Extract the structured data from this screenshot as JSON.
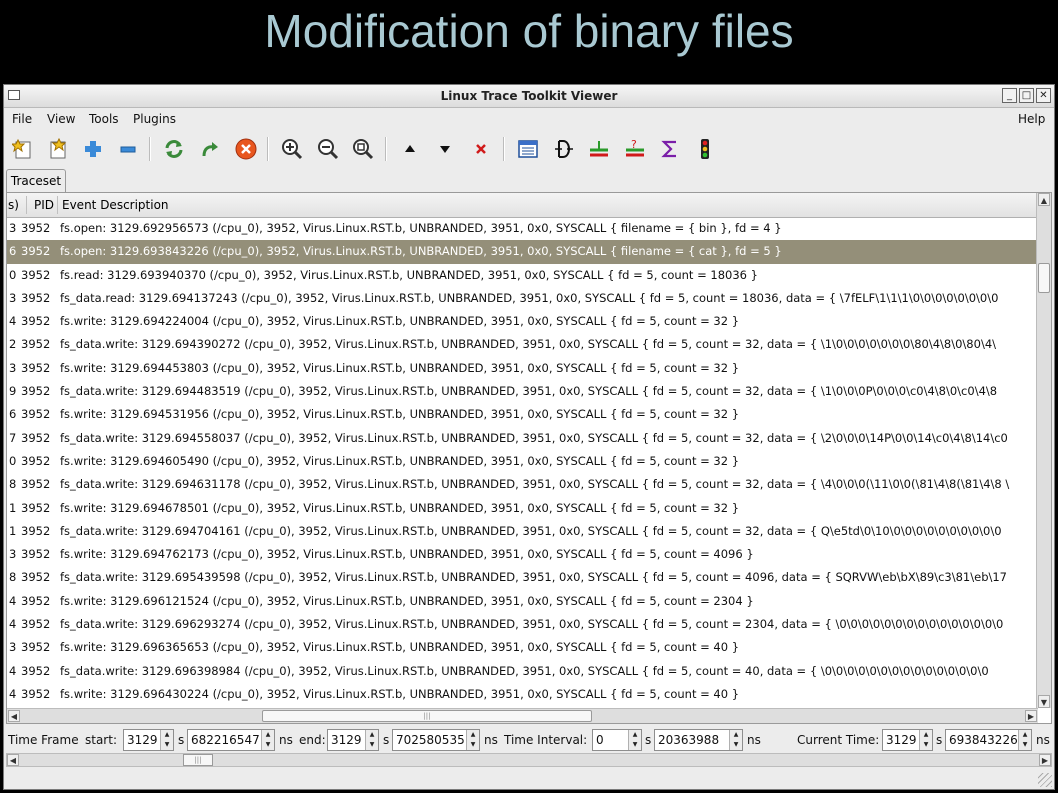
{
  "slide": {
    "title": "Modification of binary files"
  },
  "window": {
    "title": "Linux Trace Toolkit Viewer",
    "buttons": {
      "minimize": "_",
      "maximize": "□",
      "close": "✕"
    }
  },
  "menubar": {
    "file": "File",
    "view": "View",
    "tools": "Tools",
    "plugins": "Plugins",
    "help": "Help"
  },
  "toolbar": {
    "icons": [
      "open-trace-icon",
      "close-trace-icon",
      "add-trace-icon",
      "remove-trace-icon",
      "reload-icon",
      "redo-icon",
      "stop-icon",
      "zoom-in-icon",
      "zoom-out-icon",
      "zoom-fit-icon",
      "go-up-icon",
      "go-down-icon",
      "delete-icon",
      "event-list-icon",
      "control-flow-icon",
      "filter-icon",
      "filter-query-icon",
      "statistics-icon",
      "traffic-light-icon"
    ]
  },
  "tabs": [
    {
      "label": "Traceset"
    }
  ],
  "table": {
    "headers": {
      "prev": "s)",
      "pid": "PID",
      "desc": "Event Description"
    },
    "rows": [
      {
        "c0": "3",
        "pid": "3952",
        "desc": "fs.open: 3129.692956573 (/cpu_0), 3952, Virus.Linux.RST.b, UNBRANDED, 3951, 0x0, SYSCALL { filename = { bin }, fd = 4 }"
      },
      {
        "c0": "6",
        "pid": "3952",
        "desc": "fs.open: 3129.693843226 (/cpu_0), 3952, Virus.Linux.RST.b, UNBRANDED, 3951, 0x0, SYSCALL { filename = { cat }, fd = 5 }"
      },
      {
        "c0": "0",
        "pid": "3952",
        "desc": "fs.read: 3129.693940370 (/cpu_0), 3952, Virus.Linux.RST.b, UNBRANDED, 3951, 0x0, SYSCALL { fd = 5, count = 18036 }"
      },
      {
        "c0": "3",
        "pid": "3952",
        "desc": "fs_data.read: 3129.694137243 (/cpu_0), 3952, Virus.Linux.RST.b, UNBRANDED, 3951, 0x0, SYSCALL { fd = 5, count = 18036, data = { \\7fELF\\1\\1\\1\\0\\0\\0\\0\\0\\0\\0\\0"
      },
      {
        "c0": "4",
        "pid": "3952",
        "desc": "fs.write: 3129.694224004 (/cpu_0), 3952, Virus.Linux.RST.b, UNBRANDED, 3951, 0x0, SYSCALL { fd = 5, count = 32 }"
      },
      {
        "c0": "2",
        "pid": "3952",
        "desc": "fs_data.write: 3129.694390272 (/cpu_0), 3952, Virus.Linux.RST.b, UNBRANDED, 3951, 0x0, SYSCALL { fd = 5, count = 32, data = { \\1\\0\\0\\0\\0\\0\\0\\0\\80\\4\\8\\0\\80\\4\\"
      },
      {
        "c0": "3",
        "pid": "3952",
        "desc": "fs.write: 3129.694453803 (/cpu_0), 3952, Virus.Linux.RST.b, UNBRANDED, 3951, 0x0, SYSCALL { fd = 5, count = 32 }"
      },
      {
        "c0": "9",
        "pid": "3952",
        "desc": "fs_data.write: 3129.694483519 (/cpu_0), 3952, Virus.Linux.RST.b, UNBRANDED, 3951, 0x0, SYSCALL { fd = 5, count = 32, data = { \\1\\0\\0\\0P\\0\\0\\0\\c0\\4\\8\\0\\c0\\4\\8"
      },
      {
        "c0": "6",
        "pid": "3952",
        "desc": "fs.write: 3129.694531956 (/cpu_0), 3952, Virus.Linux.RST.b, UNBRANDED, 3951, 0x0, SYSCALL { fd = 5, count = 32 }"
      },
      {
        "c0": "7",
        "pid": "3952",
        "desc": "fs_data.write: 3129.694558037 (/cpu_0), 3952, Virus.Linux.RST.b, UNBRANDED, 3951, 0x0, SYSCALL { fd = 5, count = 32, data = { \\2\\0\\0\\0\\14P\\0\\0\\14\\c0\\4\\8\\14\\c0"
      },
      {
        "c0": "0",
        "pid": "3952",
        "desc": "fs.write: 3129.694605490 (/cpu_0), 3952, Virus.Linux.RST.b, UNBRANDED, 3951, 0x0, SYSCALL { fd = 5, count = 32 }"
      },
      {
        "c0": "8",
        "pid": "3952",
        "desc": "fs_data.write: 3129.694631178 (/cpu_0), 3952, Virus.Linux.RST.b, UNBRANDED, 3951, 0x0, SYSCALL { fd = 5, count = 32, data = { \\4\\0\\0\\0(\\11\\0\\0(\\81\\4\\8(\\81\\4\\8 \\"
      },
      {
        "c0": "1",
        "pid": "3952",
        "desc": "fs.write: 3129.694678501 (/cpu_0), 3952, Virus.Linux.RST.b, UNBRANDED, 3951, 0x0, SYSCALL { fd = 5, count = 32 }"
      },
      {
        "c0": "1",
        "pid": "3952",
        "desc": "fs_data.write: 3129.694704161 (/cpu_0), 3952, Virus.Linux.RST.b, UNBRANDED, 3951, 0x0, SYSCALL { fd = 5, count = 32, data = { Q\\e5td\\0\\10\\0\\0\\0\\0\\0\\0\\0\\0\\0\\0"
      },
      {
        "c0": "3",
        "pid": "3952",
        "desc": "fs.write: 3129.694762173 (/cpu_0), 3952, Virus.Linux.RST.b, UNBRANDED, 3951, 0x0, SYSCALL { fd = 5, count = 4096 }"
      },
      {
        "c0": "8",
        "pid": "3952",
        "desc": "fs_data.write: 3129.695439598 (/cpu_0), 3952, Virus.Linux.RST.b, UNBRANDED, 3951, 0x0, SYSCALL { fd = 5, count = 4096, data = { SQRVW\\eb\\bX\\89\\c3\\81\\eb\\17"
      },
      {
        "c0": "4",
        "pid": "3952",
        "desc": "fs.write: 3129.696121524 (/cpu_0), 3952, Virus.Linux.RST.b, UNBRANDED, 3951, 0x0, SYSCALL { fd = 5, count = 2304 }"
      },
      {
        "c0": "4",
        "pid": "3952",
        "desc": "fs_data.write: 3129.696293274 (/cpu_0), 3952, Virus.Linux.RST.b, UNBRANDED, 3951, 0x0, SYSCALL { fd = 5, count = 2304, data = { \\0\\0\\0\\0\\0\\0\\0\\0\\0\\0\\0\\0\\0\\0\\0"
      },
      {
        "c0": "3",
        "pid": "3952",
        "desc": "fs.write: 3129.696365653 (/cpu_0), 3952, Virus.Linux.RST.b, UNBRANDED, 3951, 0x0, SYSCALL { fd = 5, count = 40 }"
      },
      {
        "c0": "4",
        "pid": "3952",
        "desc": "fs_data.write: 3129.696398984 (/cpu_0), 3952, Virus.Linux.RST.b, UNBRANDED, 3951, 0x0, SYSCALL { fd = 5, count = 40, data = { \\0\\0\\0\\0\\0\\0\\0\\0\\0\\0\\0\\0\\0\\0\\0"
      },
      {
        "c0": "4",
        "pid": "3952",
        "desc": "fs.write: 3129.696430224 (/cpu_0), 3952, Virus.Linux.RST.b, UNBRANDED, 3951, 0x0, SYSCALL { fd = 5, count = 40 }"
      }
    ],
    "selected_row": 1,
    "hscroll_grip": "|||"
  },
  "status": {
    "time_frame_label": "Time Frame",
    "start_label": "start:",
    "start_s": "3129",
    "s1": "s",
    "start_ns": "682216547",
    "ns1": "ns",
    "end_label": "end:",
    "end_s": "3129",
    "s2": "s",
    "end_ns": "702580535",
    "ns2": "ns",
    "interval_label": "Time Interval:",
    "interval_s": "0",
    "s3": "s",
    "interval_ns": "20363988",
    "ns3": "ns",
    "current_label": "Current Time:",
    "current_s": "3129",
    "s4": "s",
    "current_ns": "693843226",
    "ns4": "ns"
  }
}
